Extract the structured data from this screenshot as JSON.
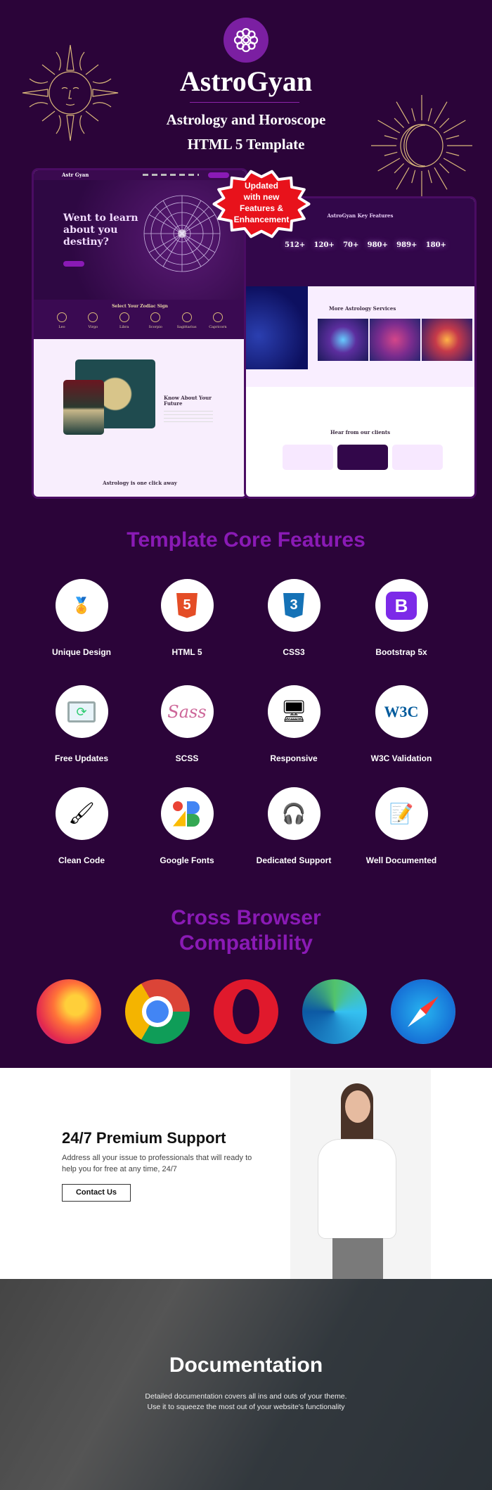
{
  "hero": {
    "brand": "AstroGyan",
    "subtitle_line1": "Astrology and Horoscope",
    "subtitle_line2": "HTML 5 Template",
    "logo_icon": "mandala-flower-icon",
    "badge": [
      "Updated",
      "with new",
      "Features &",
      "Enhancement"
    ]
  },
  "mockup_left": {
    "logo": "Astr Gyan",
    "hero_heading": [
      "Went to learn",
      "about you",
      "destiny?"
    ],
    "zodiac_title": "Select Your Zodiac Sign",
    "zodiac_signs": [
      "Leo",
      "Virgo",
      "Libra",
      "Scorpio",
      "Sagittarius",
      "Capricorn"
    ],
    "know_title": [
      "Know About Your",
      "Future"
    ],
    "bottom_title": "Astrology is one click away"
  },
  "mockup_right": {
    "features_title": "AstroGyan Key Features",
    "stats": [
      "512+",
      "120+",
      "70+",
      "980+",
      "989+",
      "180+"
    ],
    "services_title": "More Astrology Services",
    "clients_title": "Hear from our clients"
  },
  "core": {
    "title": "Template Core Features",
    "items": [
      {
        "label": "Unique Design",
        "icon": "award-boxes-icon"
      },
      {
        "label": "HTML 5",
        "icon": "html5-icon"
      },
      {
        "label": "CSS3",
        "icon": "css3-icon"
      },
      {
        "label": "Bootstrap 5x",
        "icon": "bootstrap-icon"
      },
      {
        "label": "Free Updates",
        "icon": "monitor-refresh-icon"
      },
      {
        "label": "SCSS",
        "icon": "sass-icon"
      },
      {
        "label": "Responsive",
        "icon": "devices-icon"
      },
      {
        "label": "W3C Validation",
        "icon": "w3c-icon"
      },
      {
        "label": "Clean Code",
        "icon": "brush-icon"
      },
      {
        "label": "Google Fonts",
        "icon": "google-fonts-icon"
      },
      {
        "label": "Dedicated Support",
        "icon": "headset-icon"
      },
      {
        "label": "Well Documented",
        "icon": "document-stamp-icon"
      }
    ]
  },
  "browsers": {
    "title_line1": "Cross Browser",
    "title_line2": "Compatibility",
    "items": [
      "firefox-icon",
      "chrome-icon",
      "opera-icon",
      "edge-icon",
      "safari-icon"
    ]
  },
  "support": {
    "title": "24/7 Premium Support",
    "text_line1": "Address all your issue to professionals that will ready to",
    "text_line2": "help you for free at any time, 24/7",
    "button": "Contact Us"
  },
  "documentation": {
    "title": "Documentation",
    "text_line1": "Detailed documentation covers all ins and outs of your theme.",
    "text_line2": "Use it to squeeze the most out of your website's functionality"
  },
  "colors": {
    "background": "#2b0439",
    "accent": "#8a1ab5",
    "badge": "#e8121b",
    "ornament": "#d9b77a"
  }
}
